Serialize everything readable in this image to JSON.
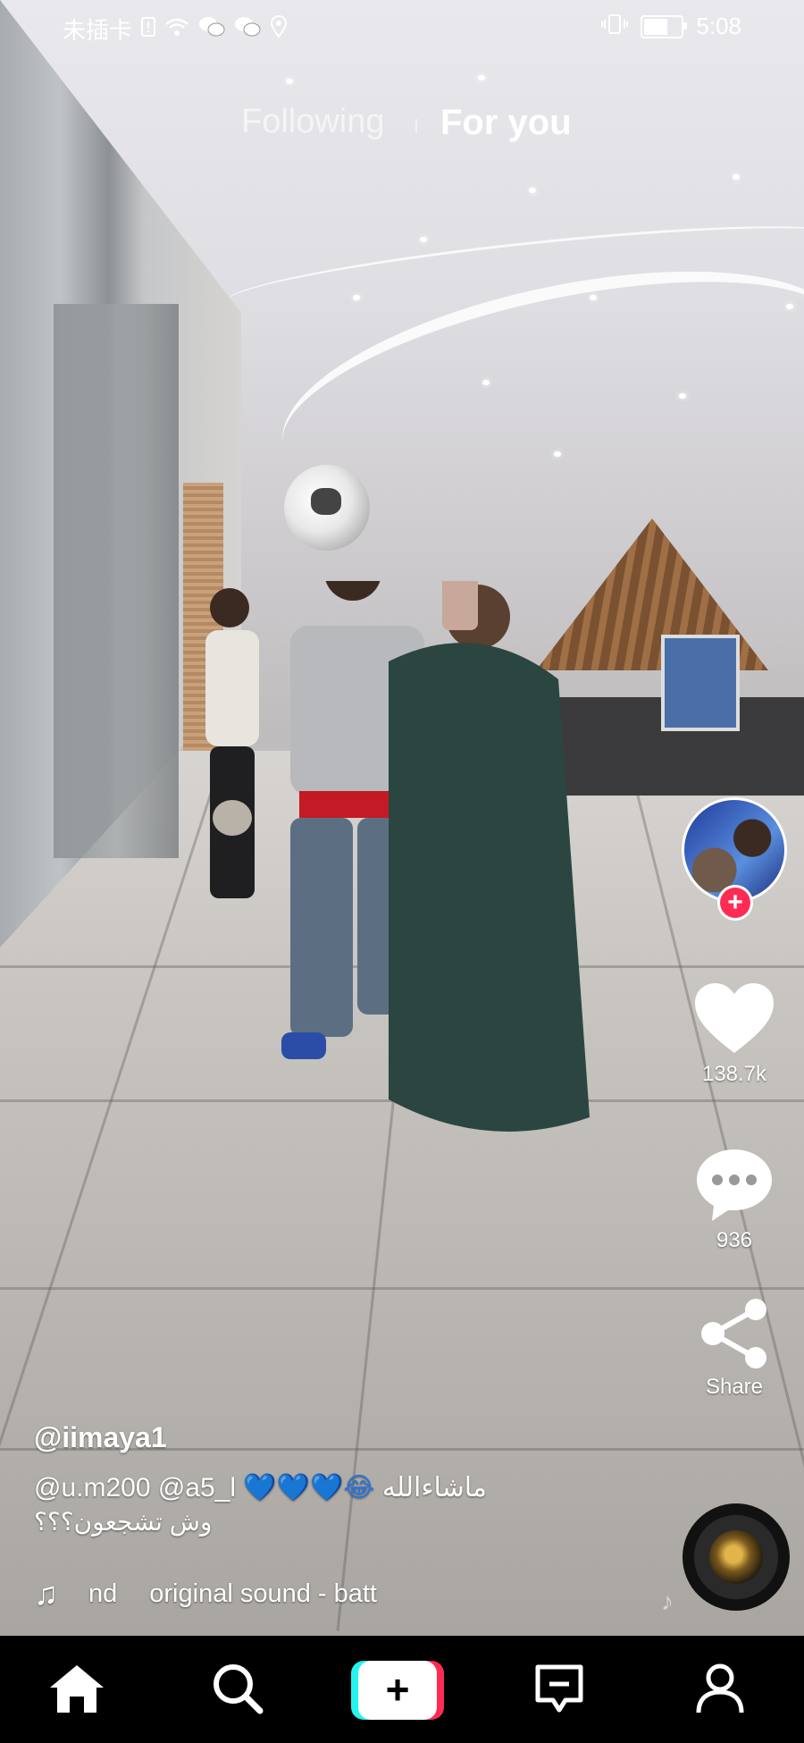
{
  "status_bar": {
    "carrier": "未插卡",
    "time": "5:08",
    "left_icons": [
      "sim-alert-icon",
      "wifi-icon",
      "wechat-icon",
      "wechat-icon",
      "location-icon"
    ],
    "right_icons": [
      "vibrate-icon",
      "battery-icon"
    ]
  },
  "tabs": {
    "following": "Following",
    "for_you": "For you"
  },
  "actions": {
    "likes": "138.7k",
    "comments": "936",
    "share": "Share"
  },
  "post": {
    "username": "@iimaya1",
    "caption_line1_mentions": "@u.m200 @a5_l",
    "caption_line1_emoji": "💙💙💙😂",
    "caption_line1_arabic": "ماشاءالله",
    "caption_line2": "وش تشجعون؟؟؟",
    "sound_prefix": "nd",
    "sound_name": "original sound - batt"
  },
  "nav": {
    "items": [
      "home-icon",
      "discover-icon",
      "create-icon",
      "inbox-icon",
      "profile-icon"
    ]
  },
  "colors": {
    "accent": "#fe2c55",
    "cyan": "#25f4ee",
    "heart_emoji": "#2b74d8"
  }
}
